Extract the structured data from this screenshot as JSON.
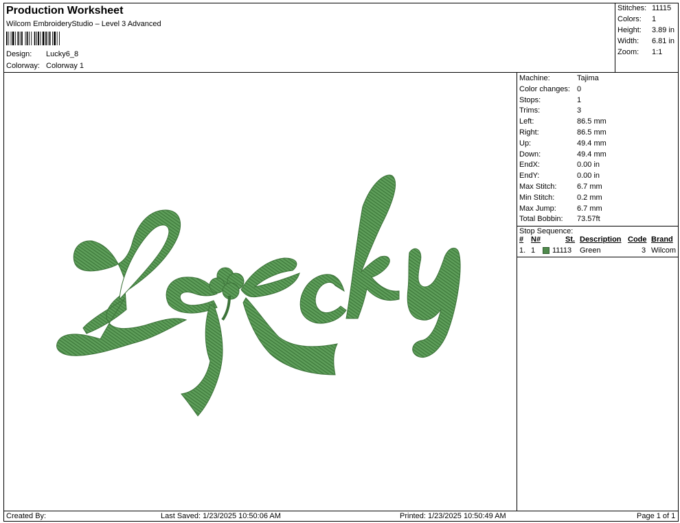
{
  "header": {
    "title": "Production Worksheet",
    "subtitle": "Wilcom EmbroideryStudio – Level 3 Advanced",
    "design_label": "Design:",
    "design_value": "Lucky6_8",
    "colorway_label": "Colorway:",
    "colorway_value": "Colorway 1"
  },
  "stats": [
    {
      "label": "Stitches:",
      "value": "11115"
    },
    {
      "label": "Colors:",
      "value": "1"
    },
    {
      "label": "Height:",
      "value": "3.89 in"
    },
    {
      "label": "Width:",
      "value": "6.81 in"
    },
    {
      "label": "Zoom:",
      "value": "1:1"
    }
  ],
  "machine_info": [
    {
      "label": "Machine:",
      "value": "Tajima"
    },
    {
      "label": "Color changes:",
      "value": "0"
    },
    {
      "label": "Stops:",
      "value": "1"
    },
    {
      "label": "Trims:",
      "value": "3"
    },
    {
      "label": "Left:",
      "value": "86.5 mm"
    },
    {
      "label": "Right:",
      "value": "86.5 mm"
    },
    {
      "label": "Up:",
      "value": "49.4 mm"
    },
    {
      "label": "Down:",
      "value": "49.4 mm"
    },
    {
      "label": "EndX:",
      "value": "0.00 in"
    },
    {
      "label": "EndY:",
      "value": "0.00 in"
    },
    {
      "label": "Max Stitch:",
      "value": "6.7 mm"
    },
    {
      "label": "Min Stitch:",
      "value": "0.2 mm"
    },
    {
      "label": "Max Jump:",
      "value": "6.7 mm"
    },
    {
      "label": "Total Bobbin:",
      "value": "73.57ft"
    }
  ],
  "stop_sequence": {
    "title": "Stop Sequence:",
    "columns": [
      "#",
      "N#",
      "St.",
      "Description",
      "Code",
      "Brand"
    ],
    "rows": [
      {
        "num": "1.",
        "n": "1",
        "st": "11113",
        "description": "Green",
        "code": "3",
        "brand": "Wilcom",
        "color": "#4f8a4c"
      }
    ]
  },
  "design": {
    "text": "Lucky",
    "thread_color": "#5a9a57"
  },
  "footer": {
    "created_by": "Created By:",
    "last_saved": "Last Saved: 1/23/2025 10:50:06 AM",
    "printed": "Printed: 1/23/2025 10:50:49 AM",
    "page": "Page 1 of 1"
  }
}
